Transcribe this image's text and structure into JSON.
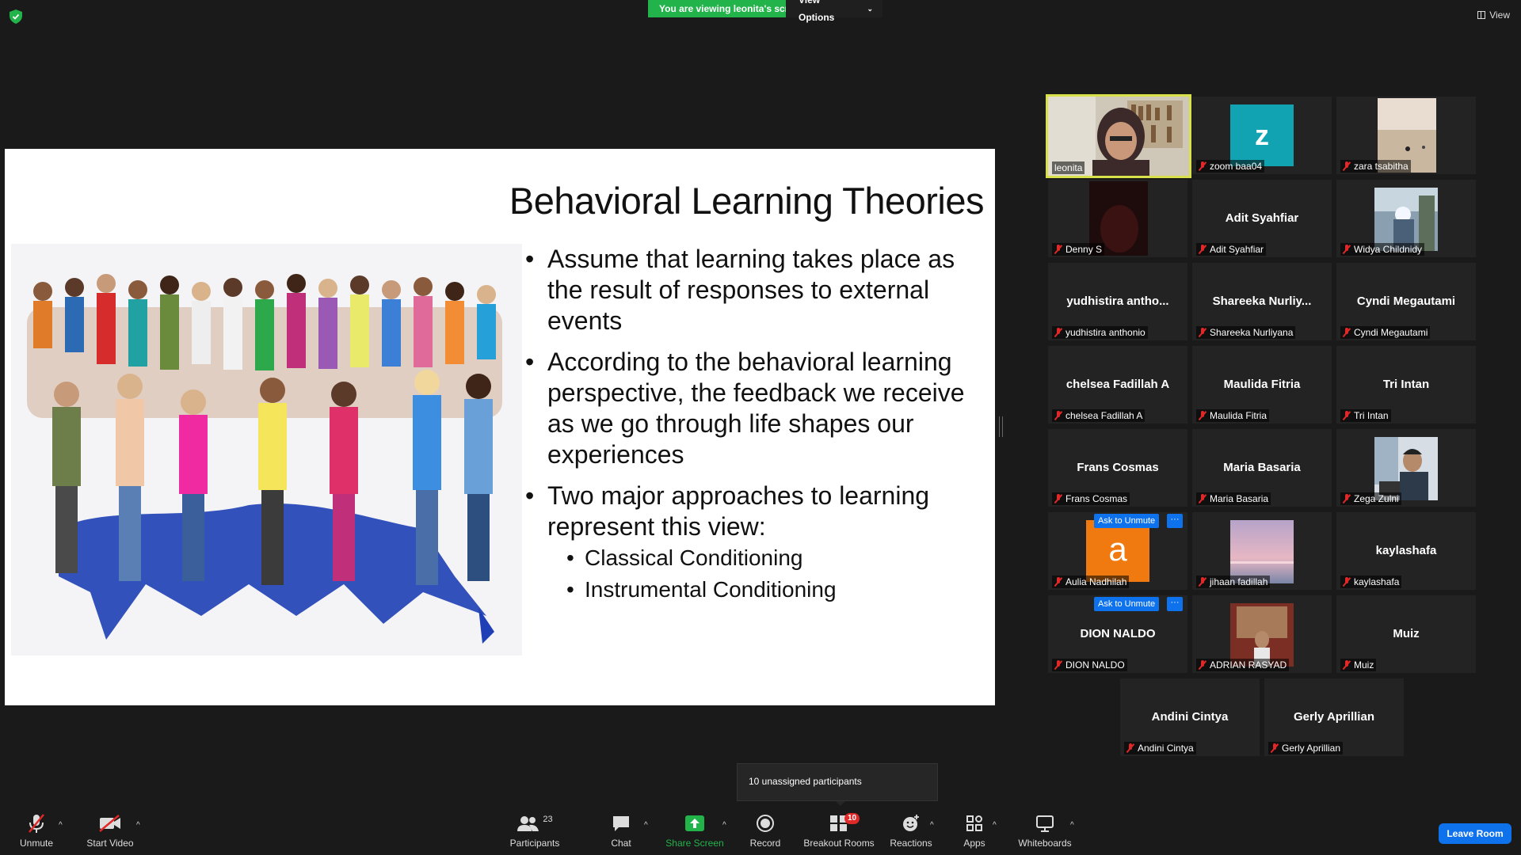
{
  "top": {
    "viewing_banner": "You are viewing leonita's screen",
    "view_options": "View Options",
    "view": "View"
  },
  "slide": {
    "title": "Behavioral Learning Theories",
    "bullets": [
      "Assume that learning takes place as the result of responses to external events",
      "According to the behavioral learning perspective, the feedback we receive as we go through life shapes our experiences",
      "Two major approaches to learning represent this view:"
    ],
    "sub_bullets": [
      "Classical Conditioning",
      "Instrumental Conditioning"
    ]
  },
  "gallery": {
    "tiles": [
      {
        "label": "leonita"
      },
      {
        "label": "zoom baa04",
        "avatar": "z"
      },
      {
        "label": "zara tsabitha"
      },
      {
        "label": "Denny S"
      },
      {
        "label": "Adit Syahfiar",
        "center": "Adit Syahfiar"
      },
      {
        "label": "Widya Childnidy"
      },
      {
        "label": "yudhistira anthonio",
        "center": "yudhistira antho..."
      },
      {
        "label": "Shareeka Nurliyana",
        "center": "Shareeka Nurliy..."
      },
      {
        "label": "Cyndi Megautami",
        "center": "Cyndi Megautami"
      },
      {
        "label": "chelsea Fadillah A",
        "center": "chelsea Fadillah A"
      },
      {
        "label": "Maulida Fitria",
        "center": "Maulida Fitria"
      },
      {
        "label": "Tri Intan",
        "center": "Tri Intan"
      },
      {
        "label": "Frans Cosmas",
        "center": "Frans Cosmas"
      },
      {
        "label": "Maria Basaria",
        "center": "Maria Basaria"
      },
      {
        "label": "Zega Zulni"
      },
      {
        "label": "Aulia Nadhilah",
        "avatar": "a"
      },
      {
        "label": "jihaan fadillah"
      },
      {
        "label": "kaylashafa",
        "center": "kaylashafa"
      },
      {
        "label": "DION NALDO",
        "center": "DION NALDO"
      },
      {
        "label": "ADRIAN RASYAD"
      },
      {
        "label": "Muiz",
        "center": "Muiz"
      },
      {
        "label": "Andini Cintya",
        "center": "Andini Cintya"
      },
      {
        "label": "Gerly Aprillian",
        "center": "Gerly Aprillian"
      }
    ],
    "ask_to_unmute": "Ask to Unmute",
    "more": "···"
  },
  "unassigned": "10 unassigned participants",
  "toolbar": {
    "unmute": "Unmute",
    "start_video": "Start Video",
    "participants": "Participants",
    "participants_count": "23",
    "chat": "Chat",
    "share_screen": "Share Screen",
    "record": "Record",
    "breakout_rooms": "Breakout Rooms",
    "breakout_count": "10",
    "reactions": "Reactions",
    "apps": "Apps",
    "whiteboards": "Whiteboards",
    "leave_room": "Leave Room"
  },
  "colors": {
    "accent": "#0e72ed",
    "banner_green": "#23b34b",
    "active_speaker": "#d8e14a",
    "muted_red": "#e02828"
  }
}
